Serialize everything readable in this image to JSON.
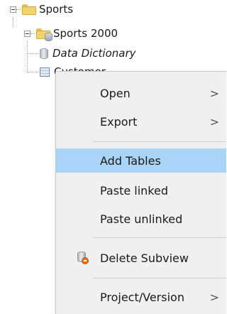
{
  "tree": {
    "root": {
      "label": "Sports"
    },
    "child": {
      "label": "Sports 2000"
    },
    "items": [
      {
        "label": "Data Dictionary"
      },
      {
        "label": "Customer"
      }
    ]
  },
  "context_menu": {
    "items": [
      {
        "label": "Open",
        "submenu_arrow": ">"
      },
      {
        "label": "Export",
        "submenu_arrow": ">"
      },
      {
        "label": "Add Tables",
        "highlighted": true
      },
      {
        "label": "Paste linked"
      },
      {
        "label": "Paste unlinked"
      },
      {
        "label": "Delete Subview",
        "icon": "delete-subview-icon"
      },
      {
        "label": "Project/Version",
        "submenu_arrow": ">"
      }
    ]
  },
  "colors": {
    "menu_bg": "#f0f0f0",
    "highlight": "#a9d4f5",
    "folder": "#f3d36b"
  }
}
